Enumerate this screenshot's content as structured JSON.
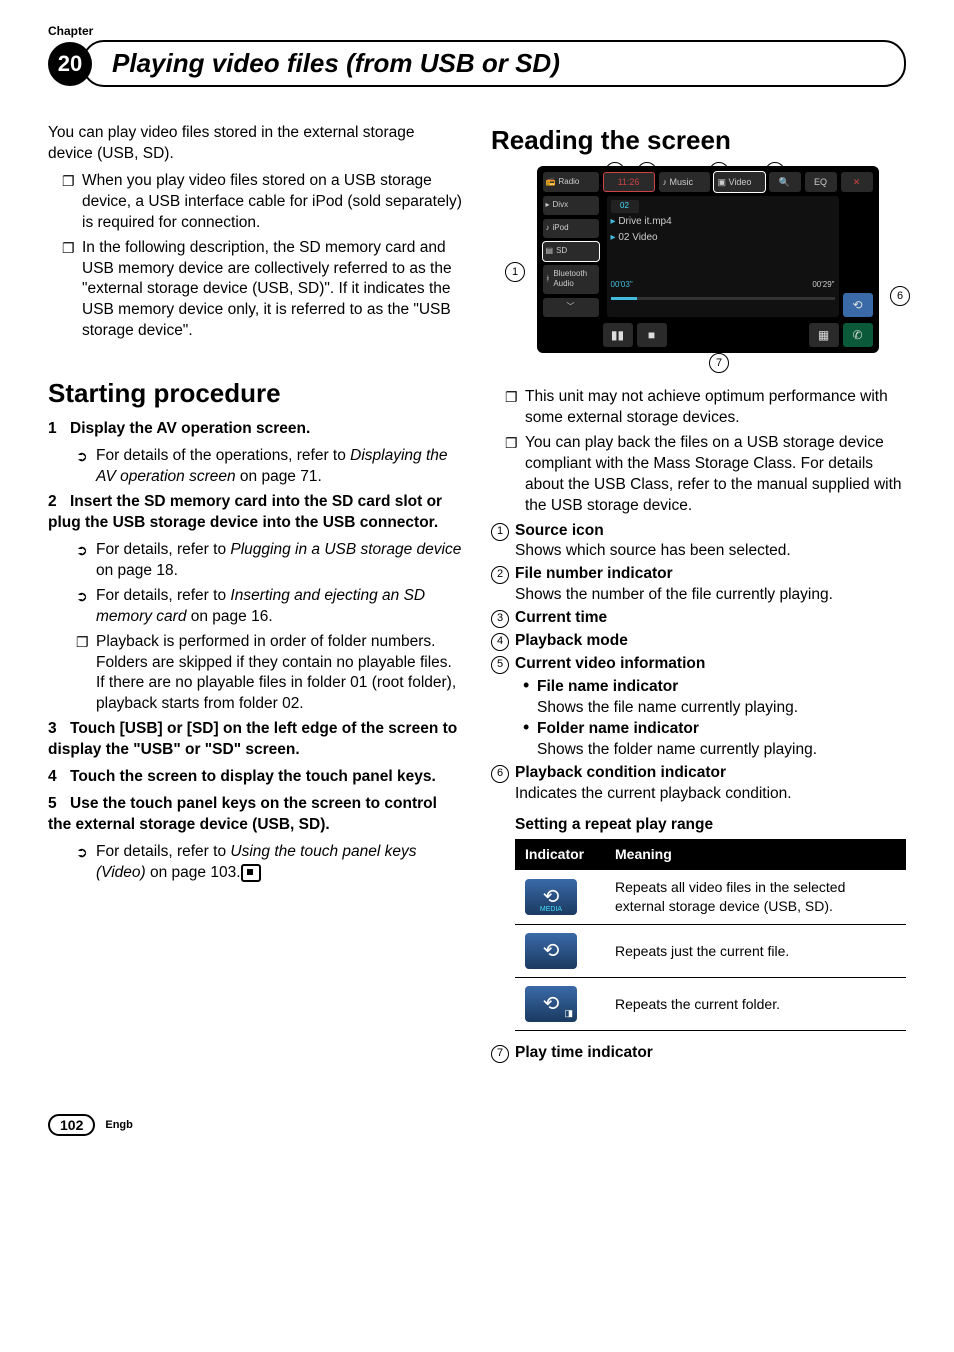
{
  "header": {
    "chapter_label": "Chapter",
    "chapter_number": "20",
    "title": "Playing video files (from USB or SD)"
  },
  "left": {
    "intro": "You can play video files stored in the external storage device (USB, SD).",
    "intro_b1": "When you play video files stored on a USB storage device, a USB interface cable for iPod (sold separately) is required for connection.",
    "intro_b2": "In the following description, the SD memory card and USB memory device are collectively referred to as the \"external storage device (USB, SD)\". If it indicates the USB memory device only, it is referred to as the \"USB storage device\".",
    "section1": "Starting procedure",
    "s1_step1": "Display the AV operation screen.",
    "s1_step1_ref_pre": "For details of the operations, refer to ",
    "s1_step1_ref_em": "Displaying the AV operation screen",
    "s1_step1_ref_post": " on page 71.",
    "s1_step2": "Insert the SD memory card into the SD card slot or plug the USB storage device into the USB connector.",
    "s1_step2_ref1_pre": "For details, refer to ",
    "s1_step2_ref1_em": "Plugging in a USB storage device",
    "s1_step2_ref1_post": " on page 18.",
    "s1_step2_ref2_pre": "For details, refer to ",
    "s1_step2_ref2_em": "Inserting and ejecting an SD memory card",
    "s1_step2_ref2_post": " on page 16.",
    "s1_step2_note": "Playback is performed in order of folder numbers. Folders are skipped if they contain no playable files. If there are no playable files in folder 01 (root folder), playback starts from folder 02.",
    "s1_step3": "Touch [USB] or [SD] on the left edge of the screen to display the \"USB\" or \"SD\" screen.",
    "s1_step4": "Touch the screen to display the touch panel keys.",
    "s1_step5": "Use the touch panel keys on the screen to control the external storage device (USB, SD).",
    "s1_step5_ref_pre": "For details, refer to ",
    "s1_step5_ref_em": "Using the touch panel keys (Video)",
    "s1_step5_ref_post": " on page 103."
  },
  "right": {
    "section2": "Reading the screen",
    "screen": {
      "time": "11:26",
      "tab_music": "♪ Music",
      "tab_video": "▣ Video",
      "src_radio": "Radio",
      "src_divx": "Divx",
      "src_ipod": "iPod",
      "src_sd": "SD",
      "src_bt": "Bluetooth Audio",
      "file_name": "Drive it.mp4",
      "folder_name": "02 Video",
      "t_elapsed": "00'03\"",
      "t_total": "00'29\"",
      "file_no": "02",
      "icon_search": "🔍",
      "icon_eq": "EQ",
      "icon_close": "✕",
      "icon_repeat": "⟲",
      "icon_pause": "▮▮",
      "icon_stop": "■",
      "icon_grid": "▦",
      "icon_phone": "✆",
      "icon_down": "﹀"
    },
    "note1": "This unit may not achieve optimum performance with some external storage devices.",
    "note2": "You can play back the files on a USB storage device compliant with the Mass Storage Class. For details about the USB Class, refer to the manual supplied with the USB storage device.",
    "l1_t": "Source icon",
    "l1_d": "Shows which source has been selected.",
    "l2_t": "File number indicator",
    "l2_d": "Shows the number of the file currently playing.",
    "l3_t": "Current time",
    "l4_t": "Playback mode",
    "l5_t": "Current video information",
    "l5a_t": "File name indicator",
    "l5a_d": "Shows the file name currently playing.",
    "l5b_t": "Folder name indicator",
    "l5b_d": "Shows the folder name currently playing.",
    "l6_t": "Playback condition indicator",
    "l6_d": "Indicates the current playback condition.",
    "table_title": "Setting a repeat play range",
    "th1": "Indicator",
    "th2": "Meaning",
    "r1": "Repeats all video files in the selected external storage device (USB, SD).",
    "r2": "Repeats just the current file.",
    "r3": "Repeats the current folder.",
    "l7_t": "Play time indicator"
  },
  "footer": {
    "page": "102",
    "lang": "Engb"
  }
}
